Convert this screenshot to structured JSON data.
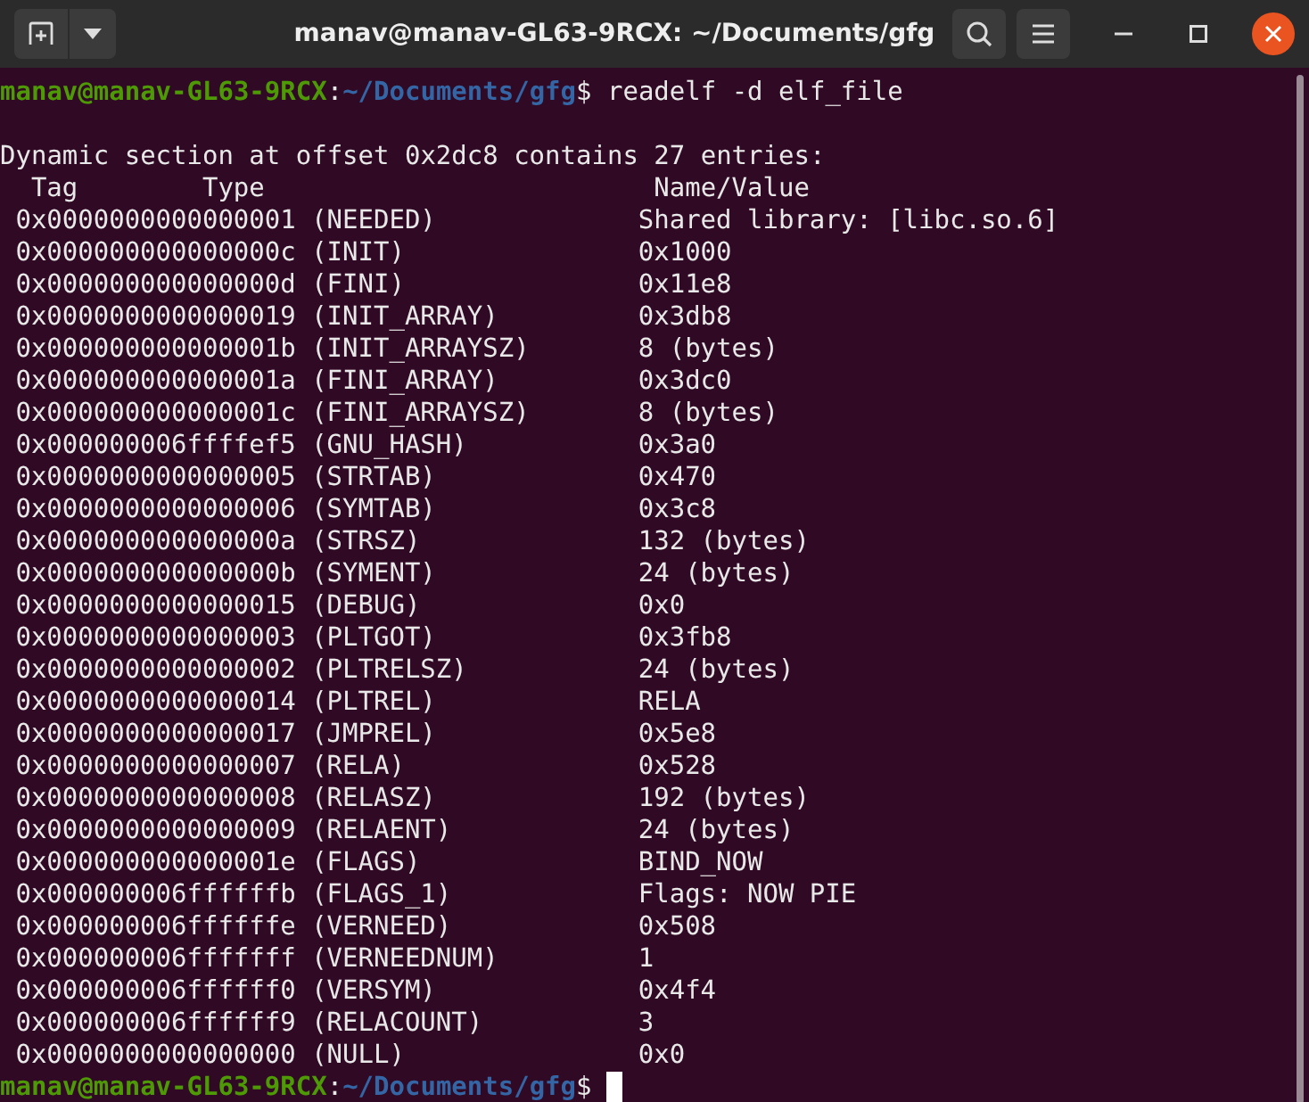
{
  "window": {
    "title": "manav@manav-GL63-9RCX: ~/Documents/gfg"
  },
  "prompt": {
    "user_host": "manav@manav-GL63-9RCX",
    "separator": ":",
    "path": "~/Documents/gfg",
    "symbol": "$",
    "command": "readelf -d elf_file"
  },
  "summary": "Dynamic section at offset 0x2dc8 contains 27 entries:",
  "columns": [
    "Tag",
    "Type",
    "Name/Value"
  ],
  "rows": [
    {
      "tag": "0x0000000000000001",
      "type": "(NEEDED)",
      "value": "Shared library: [libc.so.6]"
    },
    {
      "tag": "0x000000000000000c",
      "type": "(INIT)",
      "value": "0x1000"
    },
    {
      "tag": "0x000000000000000d",
      "type": "(FINI)",
      "value": "0x11e8"
    },
    {
      "tag": "0x0000000000000019",
      "type": "(INIT_ARRAY)",
      "value": "0x3db8"
    },
    {
      "tag": "0x000000000000001b",
      "type": "(INIT_ARRAYSZ)",
      "value": "8 (bytes)"
    },
    {
      "tag": "0x000000000000001a",
      "type": "(FINI_ARRAY)",
      "value": "0x3dc0"
    },
    {
      "tag": "0x000000000000001c",
      "type": "(FINI_ARRAYSZ)",
      "value": "8 (bytes)"
    },
    {
      "tag": "0x000000006ffffef5",
      "type": "(GNU_HASH)",
      "value": "0x3a0"
    },
    {
      "tag": "0x0000000000000005",
      "type": "(STRTAB)",
      "value": "0x470"
    },
    {
      "tag": "0x0000000000000006",
      "type": "(SYMTAB)",
      "value": "0x3c8"
    },
    {
      "tag": "0x000000000000000a",
      "type": "(STRSZ)",
      "value": "132 (bytes)"
    },
    {
      "tag": "0x000000000000000b",
      "type": "(SYMENT)",
      "value": "24 (bytes)"
    },
    {
      "tag": "0x0000000000000015",
      "type": "(DEBUG)",
      "value": "0x0"
    },
    {
      "tag": "0x0000000000000003",
      "type": "(PLTGOT)",
      "value": "0x3fb8"
    },
    {
      "tag": "0x0000000000000002",
      "type": "(PLTRELSZ)",
      "value": "24 (bytes)"
    },
    {
      "tag": "0x0000000000000014",
      "type": "(PLTREL)",
      "value": "RELA"
    },
    {
      "tag": "0x0000000000000017",
      "type": "(JMPREL)",
      "value": "0x5e8"
    },
    {
      "tag": "0x0000000000000007",
      "type": "(RELA)",
      "value": "0x528"
    },
    {
      "tag": "0x0000000000000008",
      "type": "(RELASZ)",
      "value": "192 (bytes)"
    },
    {
      "tag": "0x0000000000000009",
      "type": "(RELAENT)",
      "value": "24 (bytes)"
    },
    {
      "tag": "0x000000000000001e",
      "type": "(FLAGS)",
      "value": "BIND_NOW"
    },
    {
      "tag": "0x000000006ffffffb",
      "type": "(FLAGS_1)",
      "value": "Flags: NOW PIE"
    },
    {
      "tag": "0x000000006ffffffe",
      "type": "(VERNEED)",
      "value": "0x508"
    },
    {
      "tag": "0x000000006fffffff",
      "type": "(VERNEEDNUM)",
      "value": "1"
    },
    {
      "tag": "0x000000006ffffff0",
      "type": "(VERSYM)",
      "value": "0x4f4"
    },
    {
      "tag": "0x000000006ffffff9",
      "type": "(RELACOUNT)",
      "value": "3"
    },
    {
      "tag": "0x0000000000000000",
      "type": "(NULL)",
      "value": "0x0"
    }
  ],
  "final_prompt": {
    "user_host": "manav@manav-GL63-9RCX",
    "separator": ":",
    "path": "~/Documents/gfg",
    "symbol": "$"
  }
}
